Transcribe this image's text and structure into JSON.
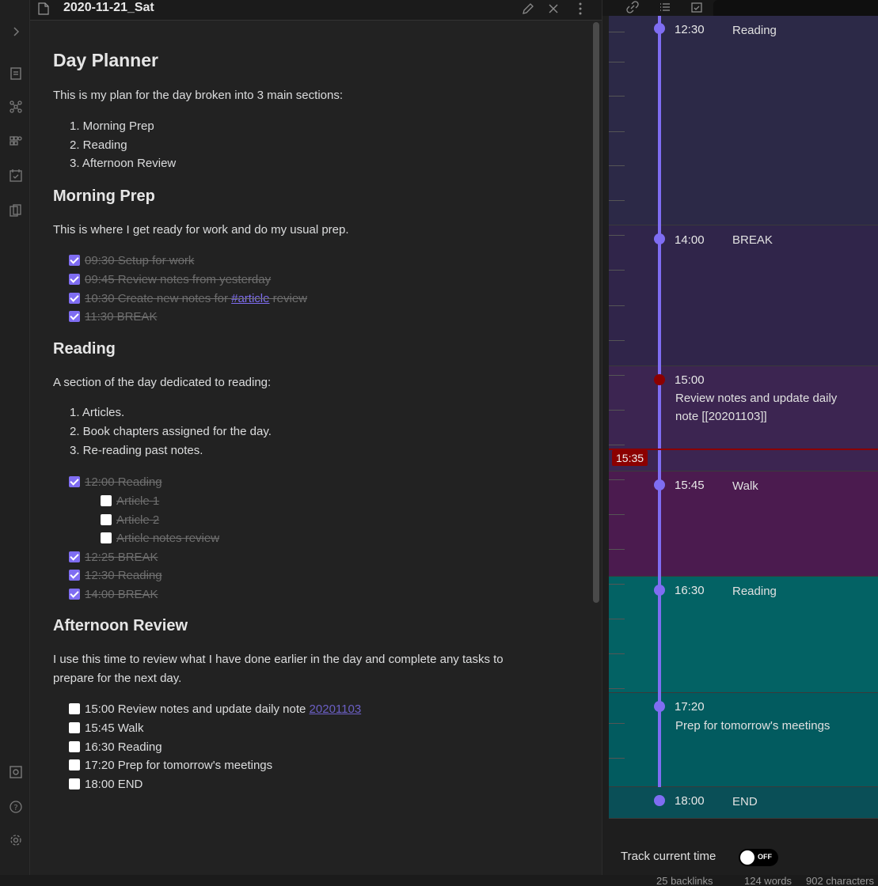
{
  "editor": {
    "title": "2020-11-21_Sat"
  },
  "note": {
    "h1": "Day Planner",
    "intro": "This is my plan for the day broken into 3 main sections:",
    "sections_list": [
      "1. Morning Prep",
      "2. Reading",
      "3. Afternoon Review"
    ],
    "morning": {
      "heading": "Morning Prep",
      "desc": "This is where I get ready for work and do my usual prep.",
      "tasks": [
        {
          "text": "09:30 Setup for work",
          "checked": true
        },
        {
          "text": "09:45 Review notes from yesterday",
          "checked": true
        },
        {
          "prefix": "10:30 Create new notes for ",
          "tag": "#article",
          "suffix": " review",
          "checked": true
        },
        {
          "text": "11:30 BREAK",
          "checked": true
        }
      ]
    },
    "reading": {
      "heading": "Reading",
      "desc": "A section of the day dedicated to reading:",
      "list": [
        "1. Articles.",
        "2. Book chapters assigned for the day.",
        "3. Re-reading past notes."
      ],
      "tasks": [
        {
          "text": "12:00 Reading",
          "checked": true
        },
        {
          "text": "Article 1",
          "checked": false,
          "indent": true
        },
        {
          "text": "Article 2",
          "checked": false,
          "indent": true
        },
        {
          "text": "Article notes review",
          "checked": false,
          "indent": true
        },
        {
          "text": "12:25 BREAK",
          "checked": true
        },
        {
          "text": "12:30 Reading",
          "checked": true
        },
        {
          "text": "14:00 BREAK",
          "checked": true
        }
      ]
    },
    "afternoon": {
      "heading": "Afternoon Review",
      "desc_line1": "I use this time to review what I have done earlier in the day and complete any tasks to",
      "desc_line2": "prepare for the next day.",
      "tasks": [
        {
          "prefix": "15:00 Review notes and update daily note ",
          "link": "20201103",
          "checked": false
        },
        {
          "text": "15:45 Walk",
          "checked": false
        },
        {
          "text": "16:30 Reading",
          "checked": false
        },
        {
          "text": "17:20 Prep for tomorrow's meetings",
          "checked": false
        },
        {
          "text": "18:00 END",
          "checked": false
        }
      ]
    }
  },
  "planner": {
    "events": [
      {
        "time": "12:30",
        "title": "Reading",
        "color": "#2c2947"
      },
      {
        "time": "14:00",
        "title": "BREAK",
        "color": "#30254a"
      },
      {
        "time": "15:00",
        "desc_line1": "Review notes and update daily",
        "desc_line2": "note [[20201103]]",
        "color": "#3c2551",
        "current": true
      },
      {
        "time": "15:45",
        "title": "Walk",
        "color": "#4b1b4f"
      },
      {
        "time": "16:30",
        "title": "Reading",
        "color": "#036264"
      },
      {
        "time": "17:20",
        "desc_line1": "Prep for tomorrow's meetings",
        "color": "#025b5f"
      },
      {
        "time": "18:00",
        "title": "END",
        "color": "#0a4f57"
      }
    ],
    "now_label": "15:35",
    "track_label": "Track current time",
    "toggle_state": "OFF"
  },
  "status": {
    "backlinks": "25 backlinks",
    "words": "124 words",
    "characters": "902 characters"
  },
  "colors": {
    "accent": "#7f6df2",
    "now": "#8b0000"
  }
}
